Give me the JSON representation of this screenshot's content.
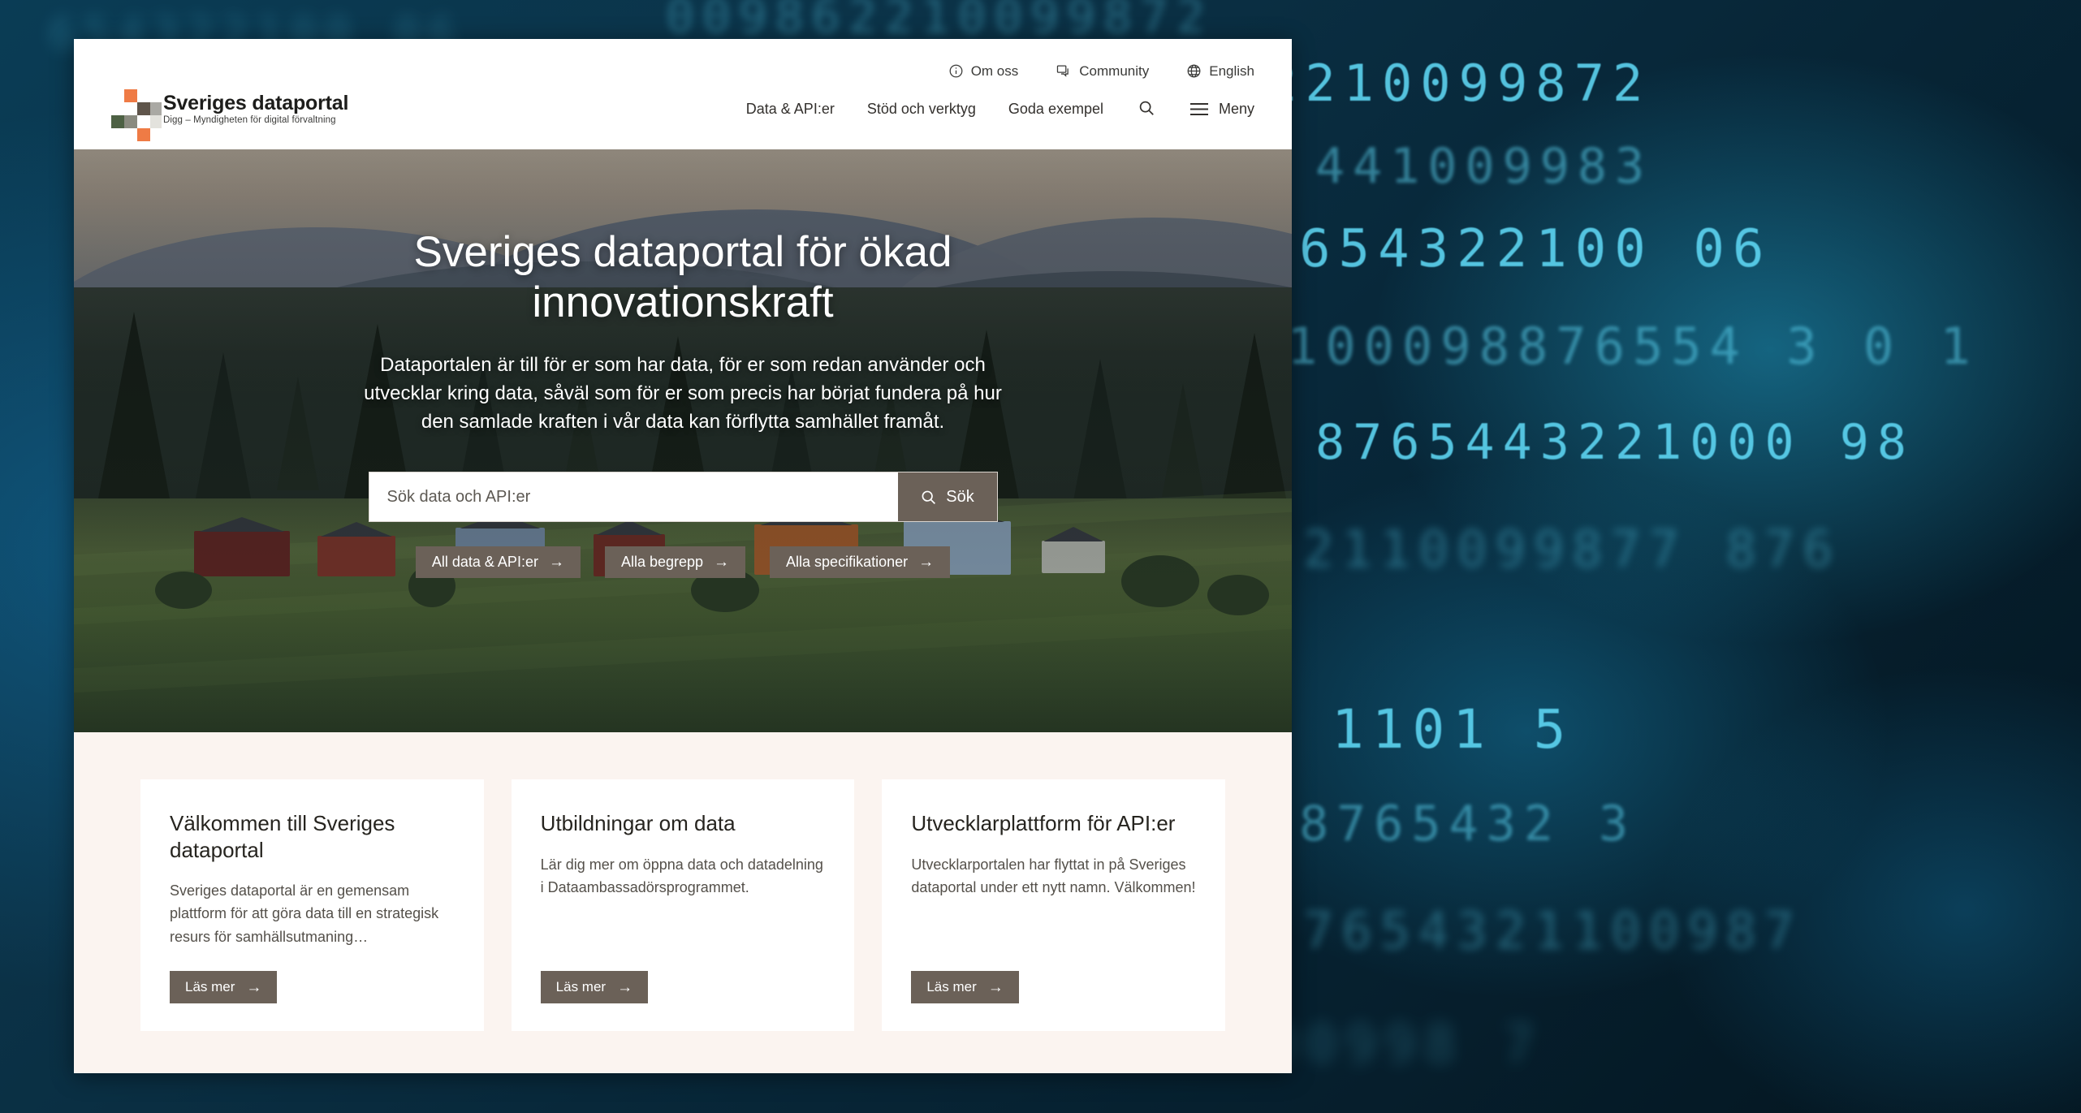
{
  "brand": {
    "title": "Sveriges dataportal",
    "subtitle": "Digg – Myndigheten för digital förvaltning",
    "logo_colors": {
      "orange": "#ef7b45",
      "dark_brown": "#5f554b",
      "gray": "#aaa9a4",
      "green": "#4d6144",
      "olive_gray": "#8a8b80",
      "light_gray": "#e3e2dd"
    }
  },
  "topbar": {
    "links": [
      {
        "label": "Om oss",
        "icon": "info-icon"
      },
      {
        "label": "Community",
        "icon": "chat-icon"
      },
      {
        "label": "English",
        "icon": "globe-icon"
      }
    ]
  },
  "mainnav": {
    "links": [
      {
        "label": "Data & API:er"
      },
      {
        "label": "Stöd och verktyg"
      },
      {
        "label": "Goda exempel"
      }
    ],
    "search_icon": "search-icon",
    "menu_label": "Meny",
    "menu_icon": "hamburger-icon"
  },
  "hero": {
    "title": "Sveriges dataportal för ökad innovationskraft",
    "lead": "Dataportalen är till för er som har data, för er som redan använder och utvecklar kring data, såväl som för er som precis har börjat fundera på hur den samlade kraften i vår data kan förflytta samhället framåt.",
    "search": {
      "placeholder": "Sök data och API:er",
      "value": "",
      "button_label": "Sök",
      "button_icon": "search-icon"
    },
    "quick_links": [
      {
        "label": "All data & API:er",
        "arrow": "→"
      },
      {
        "label": "Alla begrepp",
        "arrow": "→"
      },
      {
        "label": "Alla specifikationer",
        "arrow": "→"
      }
    ]
  },
  "cards": [
    {
      "title": "Välkommen till Sveriges dataportal",
      "body": "Sveriges dataportal är en gemensam plattform för att göra data till en strategisk resurs för samhällsutmaning…",
      "button_label": "Läs mer",
      "arrow": "→"
    },
    {
      "title": "Utbildningar om data",
      "body": "Lär dig mer om öppna data och datadelning i Dataambassadörsprogrammet.",
      "button_label": "Läs mer",
      "arrow": "→"
    },
    {
      "title": "Utvecklarplattform för API:er",
      "body": "Utvecklarportalen har flyttat in på Sveriges dataportal under ett nytt namn. Välkommen!",
      "button_label": "Läs mer",
      "arrow": "→"
    }
  ],
  "theme": {
    "accent_brown": "#6b6158",
    "card_section_bg": "#fbf4f0",
    "page_bg": "#ffffff",
    "backdrop_blue": "#0a3c55",
    "digit_glow": "#5fd8f5"
  },
  "backdrop": {
    "description": "blurred blue binary digits wallpaper",
    "digit_rows": [
      "009862210099872",
      "2210099872",
      "441009983",
      "654322100 06",
      "100098876554 3 0 1",
      "8765443221000 98",
      "2110099877 876",
      "1101 5",
      "8765432 3",
      "7654321100987",
      "00998 7"
    ]
  }
}
